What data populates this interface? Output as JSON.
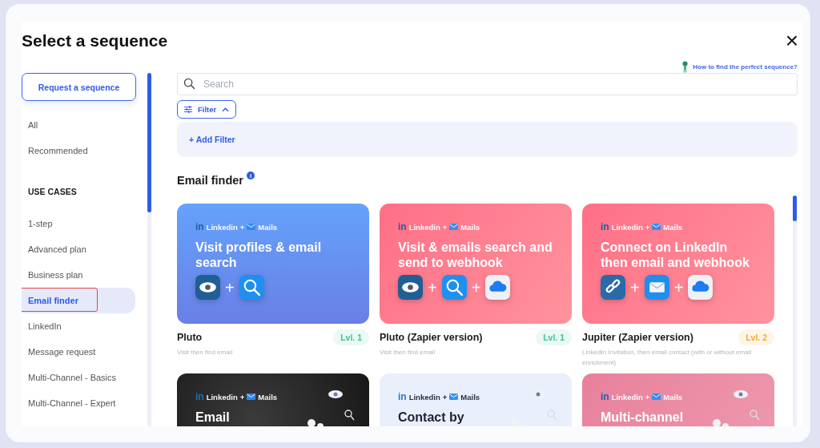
{
  "modal": {
    "title": "Select a sequence",
    "close": "×"
  },
  "sidebar": {
    "request_button": "Request a sequence",
    "items": [
      {
        "label": "All",
        "selected": false
      },
      {
        "label": "Recommended",
        "selected": false
      }
    ],
    "section_heading": "USE CASES",
    "use_cases": [
      {
        "label": "1-step",
        "selected": false
      },
      {
        "label": "Advanced plan",
        "selected": false
      },
      {
        "label": "Business plan",
        "selected": false
      },
      {
        "label": "Email finder",
        "selected": true
      },
      {
        "label": "LinkedIn",
        "selected": false
      },
      {
        "label": "Message request",
        "selected": false
      },
      {
        "label": "Multi-Channel - Basics",
        "selected": false
      },
      {
        "label": "Multi-Channel - Expert",
        "selected": false
      }
    ]
  },
  "help_link": "How to find the perfect sequence?",
  "search": {
    "placeholder": "Search"
  },
  "filter": {
    "label": "Filter",
    "expanded": true,
    "add_filter": "+ Add Filter"
  },
  "section": {
    "title": "Email finder",
    "info": "i"
  },
  "cards": [
    {
      "kind": "blue",
      "tag": {
        "logo": "in",
        "left": "Linkedin",
        "joiner": "+",
        "right": "Mails"
      },
      "headline": "Visit profiles & email search",
      "icons": [
        {
          "kind": "eye"
        },
        {
          "kind": "search"
        }
      ],
      "plus": "+",
      "title": "Pluto",
      "level": {
        "label": "Lvl. 1",
        "color": "#3cc48f"
      },
      "description": "Visit then find email"
    },
    {
      "kind": "red",
      "tag": {
        "logo": "in",
        "left": "Linkedin",
        "joiner": "+",
        "right": "Mails"
      },
      "headline": "Visit & emails search and send to webhook",
      "icons": [
        {
          "kind": "eye"
        },
        {
          "kind": "search"
        },
        {
          "kind": "cloud"
        }
      ],
      "plus": "+",
      "title": "Pluto (Zapier version)",
      "level": {
        "label": "Lvl. 1",
        "color": "#3cc48f"
      },
      "description": "Visit then find email"
    },
    {
      "kind": "red",
      "tag": {
        "logo": "in",
        "left": "Linkedin",
        "joiner": "+",
        "right": "Mails"
      },
      "headline": "Connect on LinkedIn then email and webhook",
      "icons": [
        {
          "kind": "link"
        },
        {
          "kind": "mail"
        },
        {
          "kind": "cloud"
        }
      ],
      "plus": "+",
      "title": "Jupiter (Zapier version)",
      "level": {
        "label": "Lvl. 2",
        "color": "#f5a83a"
      },
      "description": "LinkedIn Invitation, then email contact (with or without email enrichment)"
    },
    {
      "kind": "dark",
      "tag": {
        "logo": "in",
        "left": "Linkedin",
        "joiner": "+",
        "right": "Mails"
      },
      "headline": "Email"
    },
    {
      "kind": "light",
      "tag": {
        "logo": "in",
        "left": "Linkedin",
        "joiner": "+",
        "right": "Mails"
      },
      "headline": "Contact by"
    },
    {
      "kind": "pink",
      "tag": {
        "logo": "in",
        "left": "Linkedin",
        "joiner": "+",
        "right": "Mails"
      },
      "headline": "Multi-channel"
    }
  ]
}
